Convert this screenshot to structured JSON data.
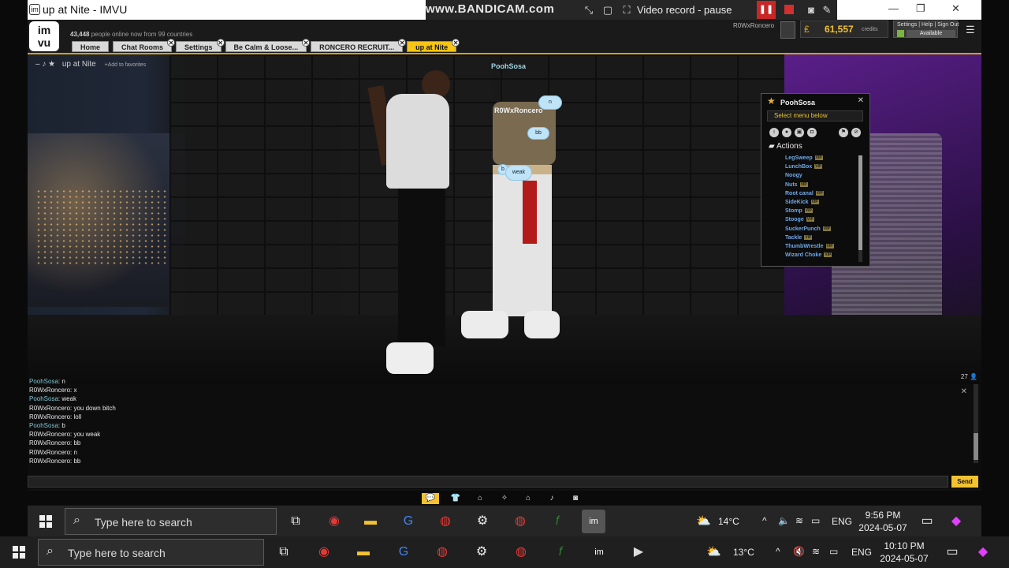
{
  "window": {
    "title": "up at Nite - IMVU",
    "app_icon": "imvu-icon"
  },
  "recorder": {
    "brand": "www.BANDICAM.com",
    "status": "Video record - pause"
  },
  "imvu": {
    "online_count": "43,448",
    "online_text": "people online now from 99 countries",
    "tabs": [
      {
        "label": "Home"
      },
      {
        "label": "Chat Rooms"
      },
      {
        "label": "Settings"
      },
      {
        "label": "Be Calm & Loose..."
      },
      {
        "label": "RONCERO RECRUIT..."
      },
      {
        "label": "up at Nite"
      }
    ],
    "username": "R0WxRoncero",
    "credits_amount": "61,557",
    "credits_label": "credits",
    "account_links": "Settings | Help | Sign Out",
    "availability": "Available"
  },
  "room": {
    "name": "up at Nite",
    "add_favorites": "Add to favorites",
    "people_count": "27"
  },
  "scene": {
    "nametag_top": "PoohSosa",
    "nametag_mid": "R0WxRoncero",
    "bubbles": [
      "n",
      "bb",
      "b",
      "weak"
    ]
  },
  "context_menu": {
    "user": "PoohSosa",
    "select_label": "Select menu below",
    "actions_header": "Actions",
    "items": [
      {
        "label": "LegSweep",
        "vip": "VIP"
      },
      {
        "label": "LunchBox",
        "vip": "VIP"
      },
      {
        "label": "Noogy",
        "vip": ""
      },
      {
        "label": "Nuts",
        "vip": "VIP"
      },
      {
        "label": "Root canal",
        "vip": "VIP"
      },
      {
        "label": "SideKick",
        "vip": "VIP"
      },
      {
        "label": "Stomp",
        "vip": "VIP"
      },
      {
        "label": "Stooge",
        "vip": "VIP"
      },
      {
        "label": "SuckerPunch",
        "vip": "VIP"
      },
      {
        "label": "Tackle",
        "vip": "VIP"
      },
      {
        "label": "ThumbWrestle",
        "vip": "VIP"
      },
      {
        "label": "Wizard Choke",
        "vip": "VIP"
      }
    ]
  },
  "chat": {
    "messages": [
      {
        "user": "PoohSosa",
        "text": "n"
      },
      {
        "user": "R0WxRoncero",
        "text": "x"
      },
      {
        "user": "PoohSosa",
        "text": "weak"
      },
      {
        "user": "R0WxRoncero",
        "text": "you down bitch"
      },
      {
        "user": "R0WxRoncero",
        "text": "loll"
      },
      {
        "user": "PoohSosa",
        "text": "b"
      },
      {
        "user": "R0WxRoncero",
        "text": "you weak"
      },
      {
        "user": "R0WxRoncero",
        "text": "bb"
      },
      {
        "user": "R0WxRoncero",
        "text": "n"
      },
      {
        "user": "R0WxRoncero",
        "text": "bb"
      }
    ],
    "send_label": "Send"
  },
  "taskbar_inner": {
    "search_placeholder": "Type here to search",
    "temperature": "14°C",
    "lang": "ENG",
    "time": "9:56 PM",
    "date": "2024-05-07"
  },
  "taskbar_outer": {
    "search_placeholder": "Type here to search",
    "temperature": "13°C",
    "lang": "ENG",
    "time": "10:10 PM",
    "date": "2024-05-07"
  },
  "colors": {
    "accent": "#f2c230",
    "imvu_blue_link": "#6ea8e8",
    "pooh_name": "#7fc6d4"
  }
}
